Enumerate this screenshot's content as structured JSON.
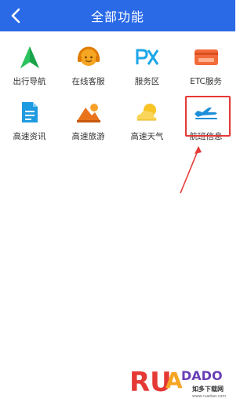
{
  "header": {
    "title": "全部功能",
    "bg_color": "#2b6ae6"
  },
  "items": [
    {
      "label": "出行导航",
      "icon": "navigation-arrow-icon"
    },
    {
      "label": "在线客服",
      "icon": "customer-service-icon"
    },
    {
      "label": "服务区",
      "icon": "service-area-px-icon"
    },
    {
      "label": "ETC服务",
      "icon": "etc-card-icon"
    },
    {
      "label": "高速资讯",
      "icon": "document-icon"
    },
    {
      "label": "高速旅游",
      "icon": "travel-landscape-icon"
    },
    {
      "label": "高速天气",
      "icon": "weather-sun-cloud-icon"
    },
    {
      "label": "航班信息",
      "icon": "airplane-icon"
    }
  ],
  "highlight_color": "#e53935",
  "watermark": {
    "brand": "RUANDADO",
    "sub": "如多下载网",
    "url": "www.ruadao.com"
  }
}
